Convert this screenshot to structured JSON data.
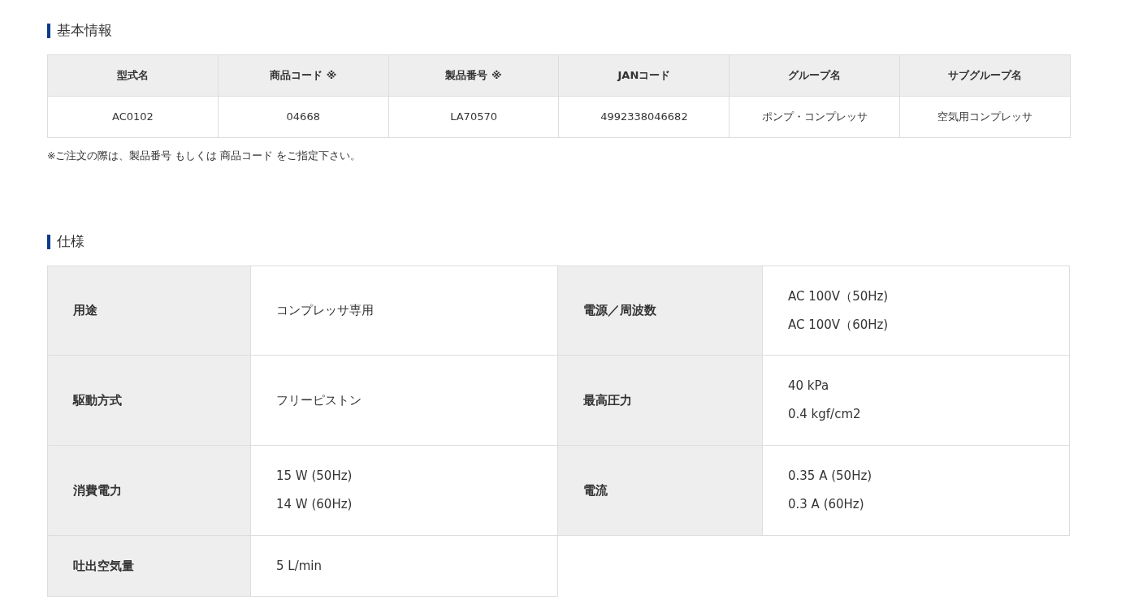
{
  "basic_info": {
    "heading": "基本情報",
    "table": {
      "columns": [
        "型式名",
        "商品コード ※",
        "製品番号 ※",
        "JANコード",
        "グループ名",
        "サブグループ名"
      ],
      "rows": [
        [
          "AC0102",
          "04668",
          "LA70570",
          "4992338046682",
          "ポンプ・コンプレッサ",
          "空気用コンプレッサ"
        ]
      ]
    },
    "note": "※ご注文の際は、製品番号 もしくは 商品コード をご指定下さい。"
  },
  "specifications": {
    "heading": "仕様",
    "rows": [
      [
        {
          "label": "用途",
          "values": [
            "コンプレッサ専用"
          ]
        },
        {
          "label": "電源／周波数",
          "values": [
            "AC 100V（50Hz)",
            "AC 100V（60Hz)"
          ]
        }
      ],
      [
        {
          "label": "駆動方式",
          "values": [
            "フリーピストン"
          ]
        },
        {
          "label": "最高圧力",
          "values": [
            "40 kPa",
            "0.4 kgf/cm2"
          ]
        }
      ],
      [
        {
          "label": "消費電力",
          "values": [
            "15 W (50Hz)",
            "14 W (60Hz)"
          ]
        },
        {
          "label": "電流",
          "values": [
            "0.35 A (50Hz)",
            "0.3 A (60Hz)"
          ]
        }
      ],
      [
        {
          "label": "吐出空気量",
          "values": [
            "5 L/min"
          ]
        }
      ]
    ]
  }
}
